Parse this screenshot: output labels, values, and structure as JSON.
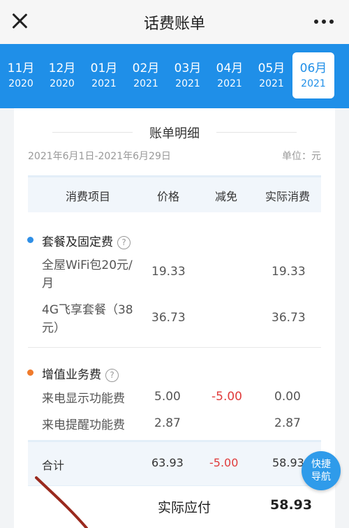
{
  "header": {
    "title": "话费账单"
  },
  "months": [
    {
      "month": "11月",
      "year": "2020"
    },
    {
      "month": "12月",
      "year": "2020"
    },
    {
      "month": "01月",
      "year": "2021"
    },
    {
      "month": "02月",
      "year": "2021"
    },
    {
      "month": "03月",
      "year": "2021"
    },
    {
      "month": "04月",
      "year": "2021"
    },
    {
      "month": "05月",
      "year": "2021"
    },
    {
      "month": "06月",
      "year": "2021"
    }
  ],
  "bill": {
    "section_title": "账单明细",
    "period": "2021年6月1日-2021年6月29日",
    "unit": "单位：元",
    "columns": [
      "消费项目",
      "价格",
      "减免",
      "实际消费"
    ],
    "groups": [
      {
        "title": "套餐及固定费",
        "dot_color": "#2f8fe6",
        "items": [
          {
            "name": "全屋WiFi包20元/月",
            "price": "19.33",
            "discount": "",
            "actual": "19.33"
          },
          {
            "name": "4G飞享套餐（38元）",
            "price": "36.73",
            "discount": "",
            "actual": "36.73"
          }
        ]
      },
      {
        "title": "增值业务费",
        "dot_color": "#f07b2c",
        "items": [
          {
            "name": "来电显示功能费",
            "price": "5.00",
            "discount": "-5.00",
            "actual": "0.00"
          },
          {
            "name": "来电提醒功能费",
            "price": "2.87",
            "discount": "",
            "actual": "2.87"
          }
        ]
      }
    ],
    "total": {
      "label": "合计",
      "price": "63.93",
      "discount": "-5.00",
      "actual": "58.93"
    },
    "payable": {
      "label": "实际应付",
      "amount": "58.93"
    },
    "help_glyph": "?"
  },
  "fab": {
    "line1": "快捷",
    "line2": "导航"
  }
}
